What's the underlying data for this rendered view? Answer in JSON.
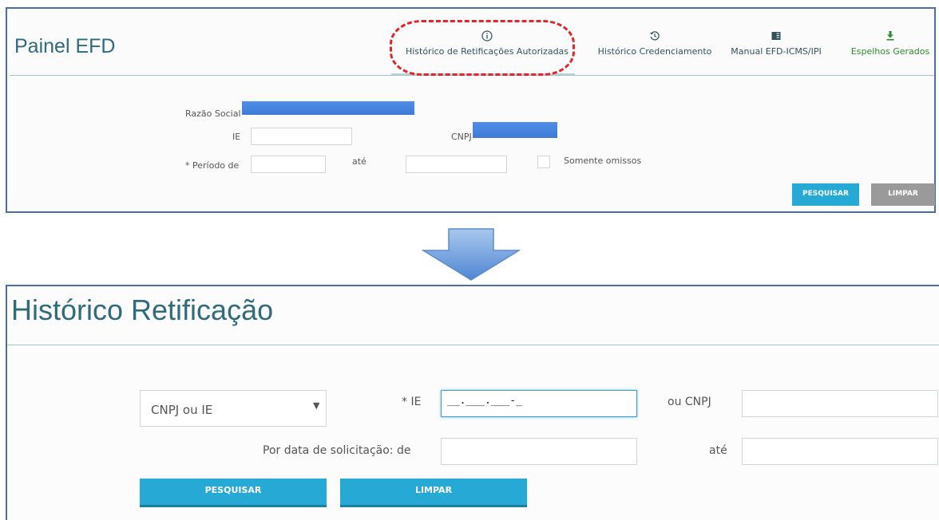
{
  "top_panel": {
    "title": "Painel EFD",
    "nav": [
      {
        "label": "Histórico de Retificações Autorizadas",
        "icon": "info-circle-icon"
      },
      {
        "label": "Histórico Credenciamento",
        "icon": "history-icon"
      },
      {
        "label": "Manual EFD-ICMS/IPI",
        "icon": "book-icon"
      },
      {
        "label": "Espelhos Gerados",
        "icon": "download-icon"
      }
    ],
    "razao_social_label": "Razão Social",
    "ie_label": "IE",
    "cnpj_label": "CNPJ",
    "periodo_label": "* Período de",
    "ate_label": "até",
    "somente_omissos_label": "Somente omissos",
    "pesquisar_label": "PESQUISAR",
    "limpar_label": "LIMPAR"
  },
  "bottom_panel": {
    "title": "Histórico Retificação",
    "select_value": "CNPJ ou IE",
    "ie_label": "* IE",
    "ie_mask": "__.___.___-_",
    "ou_cnpj_label": "ou CNPJ",
    "por_data_label": "Por data de solicitação: de",
    "ate_label": "até",
    "pesquisar_label": "PESQUISAR",
    "limpar_label": "LIMPAR"
  },
  "colors": {
    "accent": "#27a9d6",
    "title": "#2f6b7d",
    "highlight": "#e0262a",
    "espelhos": "#2e8b2e"
  }
}
